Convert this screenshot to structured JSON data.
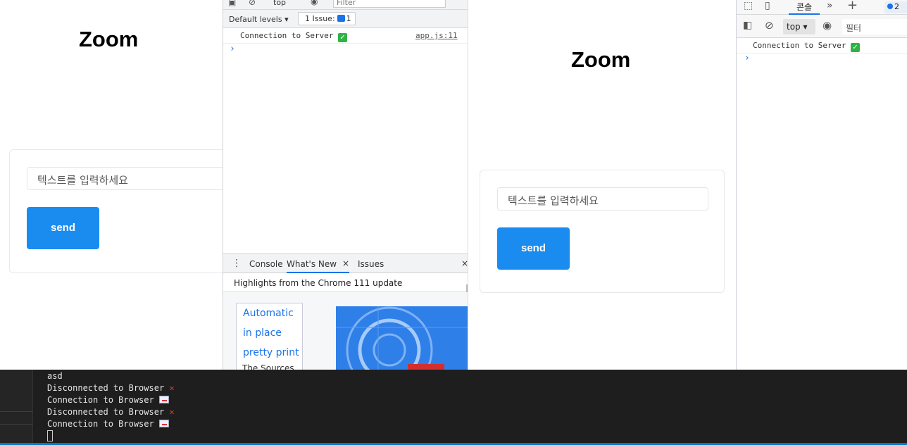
{
  "left_app": {
    "title": "Zoom",
    "input_placeholder": "텍스트를 입력하세요",
    "send_label": "send"
  },
  "devtools_middle": {
    "toolbar": {
      "context": "top",
      "filter_placeholder": "Filter",
      "levels": "Default levels",
      "issues_label": "1 Issue:",
      "issues_count": "1"
    },
    "console": {
      "message": "Connection to Server",
      "source": "app.js:11",
      "prompt": "›"
    },
    "drawer": {
      "tabs": [
        "Console",
        "What's New",
        "Issues"
      ],
      "close": "×",
      "highlights": "Highlights from the Chrome 111 update",
      "links": [
        "Automatic",
        "in place",
        "pretty print"
      ],
      "sub_text": "The Sources"
    }
  },
  "right_app": {
    "title": "Zoom",
    "input_placeholder": "텍스트를 입력하세요",
    "send_label": "send"
  },
  "devtools_right": {
    "tab_console": "콘솔",
    "more": "»",
    "add": "+",
    "badge_count": "2",
    "context": "top",
    "filter_placeholder": "필터",
    "console_message": "Connection to Server",
    "prompt": "›"
  },
  "terminal": {
    "lines": [
      "asd",
      "Disconnected to Browser",
      "Connection to Browser",
      "Disconnected to Browser",
      "Connection to Browser"
    ]
  },
  "colors": {
    "accent_blue": "#1a8cf0",
    "terminal_bg": "#1e1e1e",
    "status_blue": "#007acc"
  }
}
